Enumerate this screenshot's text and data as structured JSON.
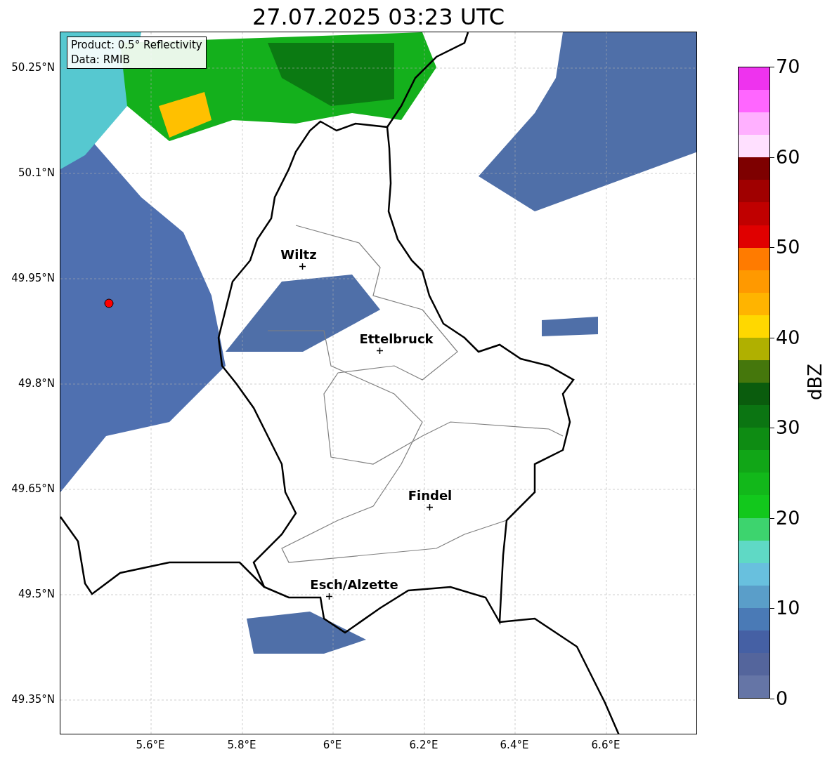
{
  "title": "27.07.2025 03:23 UTC",
  "info_box": [
    "Product: 0.5° Reflectivity",
    "Data: RMIB"
  ],
  "map": {
    "cities": [
      {
        "label": "Wiltz"
      },
      {
        "label": "Ettelbruck"
      },
      {
        "label": "Findel"
      },
      {
        "label": "Esch/Alzette"
      }
    ]
  },
  "x_ticks": [
    "5.6°E",
    "5.8°E",
    "6°E",
    "6.2°E",
    "6.4°E",
    "6.6°E"
  ],
  "y_ticks": [
    "50.25°N",
    "50.1°N",
    "49.95°N",
    "49.8°N",
    "49.65°N",
    "49.5°N",
    "49.35°N"
  ],
  "colorbar": {
    "label": "dBZ",
    "ticks": [
      "70",
      "60",
      "50",
      "40",
      "30",
      "20",
      "10",
      "0"
    ],
    "bins": [
      {
        "color": "#ee33ee"
      },
      {
        "color": "#ff66ff"
      },
      {
        "color": "#ffb0ff"
      },
      {
        "color": "#ffe0ff"
      },
      {
        "color": "#7e0000"
      },
      {
        "color": "#a00000"
      },
      {
        "color": "#c00000"
      },
      {
        "color": "#e00000"
      },
      {
        "color": "#ff7b00"
      },
      {
        "color": "#ff9900"
      },
      {
        "color": "#ffb400"
      },
      {
        "color": "#ffd800"
      },
      {
        "color": "#b0b000"
      },
      {
        "color": "#45770c"
      },
      {
        "color": "#0a5c0d"
      },
      {
        "color": "#0b7512"
      },
      {
        "color": "#0e8c13"
      },
      {
        "color": "#11a617"
      },
      {
        "color": "#12b81a"
      },
      {
        "color": "#12c81c"
      },
      {
        "color": "#3dd46e"
      },
      {
        "color": "#5fd9c5"
      },
      {
        "color": "#68c0de"
      },
      {
        "color": "#5a9ec9"
      },
      {
        "color": "#4a7ab6"
      },
      {
        "color": "#4560a4"
      },
      {
        "color": "#54659c"
      },
      {
        "color": "#6575a6"
      }
    ]
  }
}
